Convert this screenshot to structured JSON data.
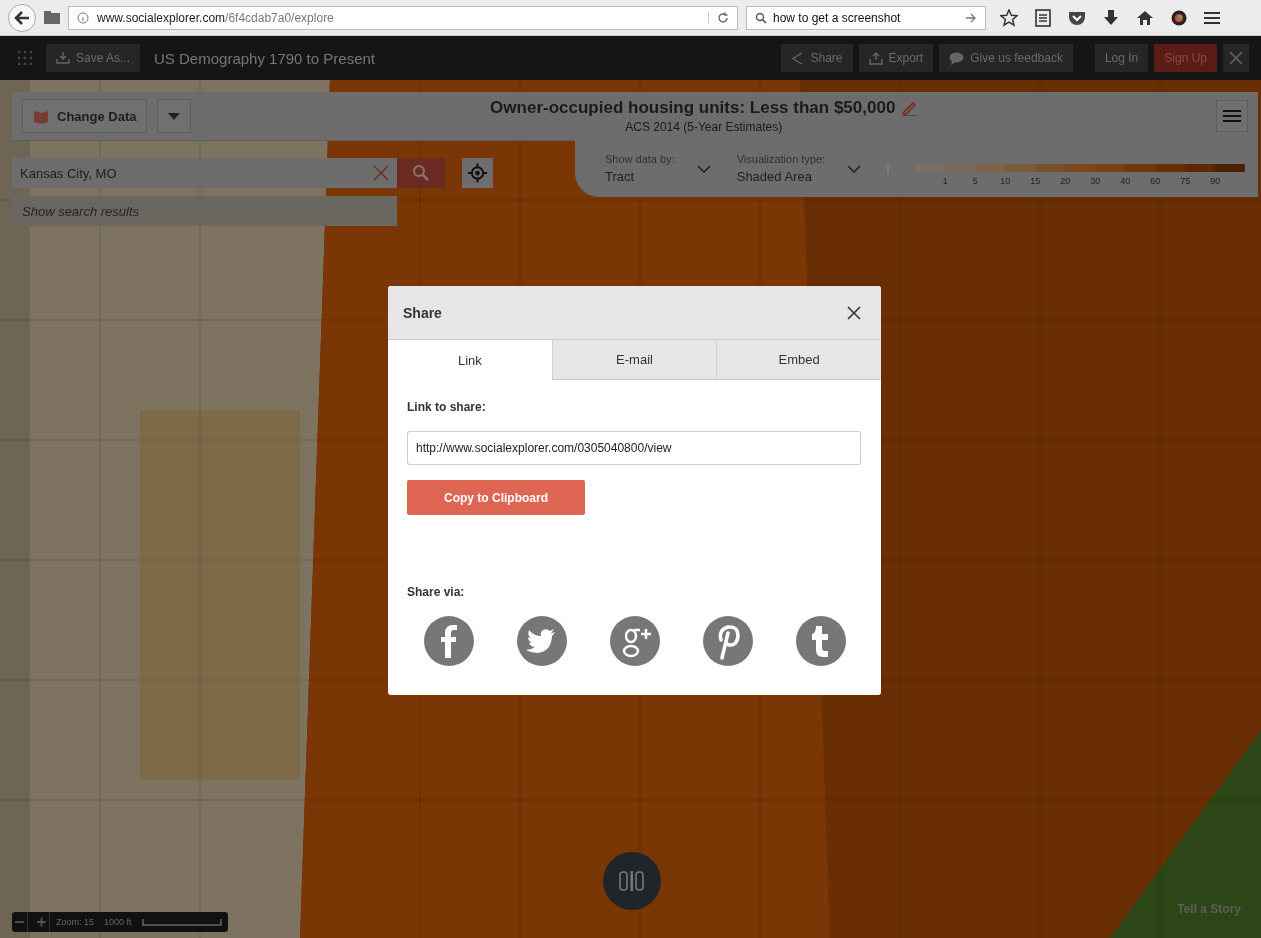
{
  "browser": {
    "url_host": "www.socialexplorer.com",
    "url_path": "/6f4cdab7a0/explore",
    "search_value": "how to get a screenshot"
  },
  "app_bar": {
    "save_as": "Save As...",
    "title": "US Demography 1790 to Present",
    "actions": [
      {
        "kind": "share",
        "label": "Share"
      },
      {
        "kind": "export",
        "label": "Export"
      },
      {
        "kind": "feedback",
        "label": "Give us feedback"
      }
    ],
    "log_in": "Log In",
    "sign_up": "Sign Up"
  },
  "data_header": {
    "change_data": "Change Data",
    "title": "Owner-occupied housing units: Less than $50,000",
    "subtitle": "ACS 2014 (5-Year Estimates)",
    "show_data_by": {
      "label": "Show data by:",
      "value": "Tract"
    },
    "visualization_type": {
      "label": "Visualization type:",
      "value": "Shaded Area"
    },
    "legend_steps": [
      {
        "color": "#7a7268"
      },
      {
        "color": "#7a6a58"
      },
      {
        "color": "#7a6448"
      },
      {
        "color": "#7a5c3c"
      },
      {
        "color": "#7a5230"
      },
      {
        "color": "#7a4820"
      },
      {
        "color": "#7a4010"
      },
      {
        "color": "#723808"
      },
      {
        "color": "#683005"
      },
      {
        "color": "#5a2804"
      },
      {
        "color": "#4a2003"
      }
    ],
    "legend_labels": [
      "1",
      "5",
      "10",
      "15",
      "20",
      "30",
      "40",
      "60",
      "75",
      "90"
    ]
  },
  "search": {
    "value": "Kansas City, MO",
    "results_hint": "Show search results"
  },
  "map_controls": {
    "zoom": "Zoom: 15",
    "scale": "1000 ft",
    "tell_a_story": "Tell a Story"
  },
  "dialog": {
    "title": "Share",
    "tabs": [
      {
        "label": "Link",
        "selected": true
      },
      {
        "label": "E-mail",
        "selected": false
      },
      {
        "label": "Embed",
        "selected": false
      }
    ],
    "link_label": "Link to share:",
    "link_value": "http://www.socialexplorer.com/0305040800/view",
    "copy_button": "Copy to Clipboard",
    "share_via_label": "Share via:",
    "share_buttons": [
      {
        "kind": "facebook"
      },
      {
        "kind": "twitter"
      },
      {
        "kind": "googleplus"
      },
      {
        "kind": "pinterest"
      },
      {
        "kind": "tumblr"
      }
    ]
  }
}
